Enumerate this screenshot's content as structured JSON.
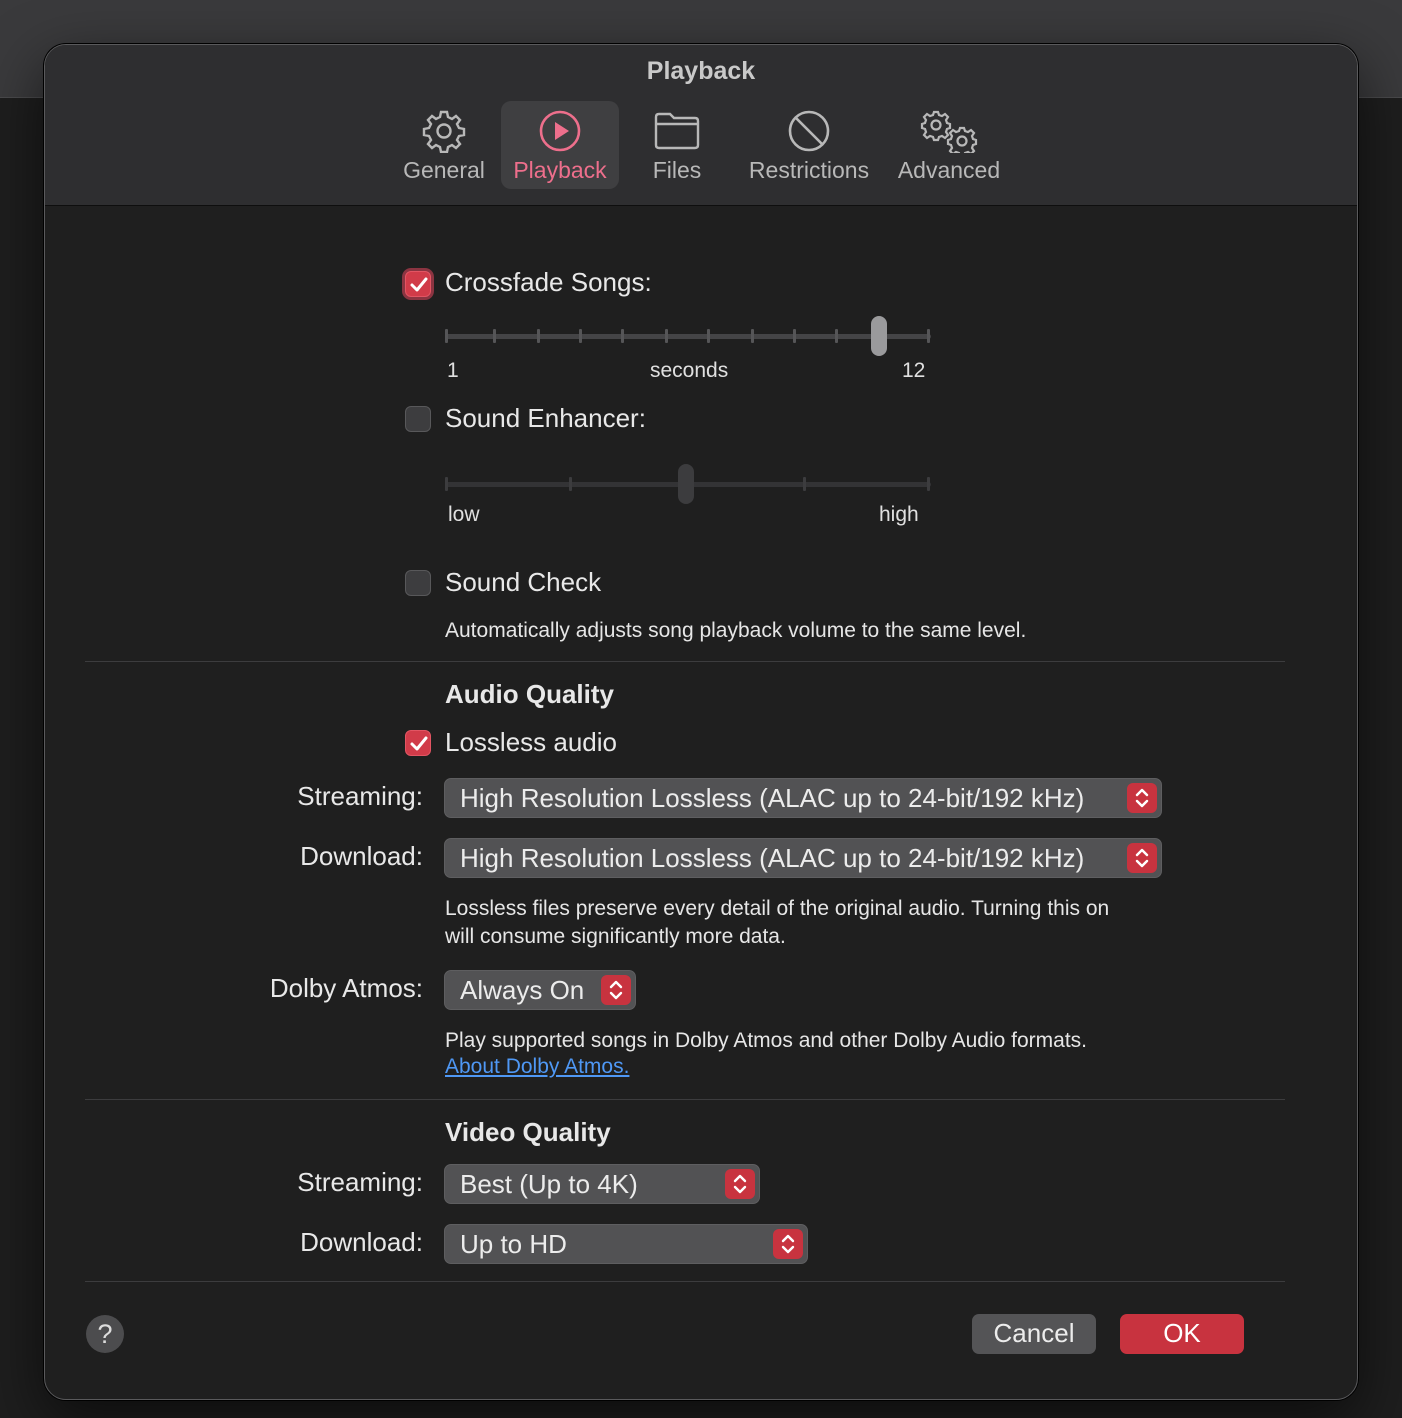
{
  "window": {
    "title": "Playback"
  },
  "tabs": [
    {
      "label": "General",
      "icon": "gear-icon"
    },
    {
      "label": "Playback",
      "icon": "play-circle-icon",
      "selected": true
    },
    {
      "label": "Files",
      "icon": "folder-icon"
    },
    {
      "label": "Restrictions",
      "icon": "prohibited-icon"
    },
    {
      "label": "Advanced",
      "icon": "gears-icon"
    }
  ],
  "crossfade": {
    "label": "Crossfade Songs:",
    "checked": true,
    "min_label": "1",
    "unit_label": "seconds",
    "max_label": "12",
    "value": 11
  },
  "sound_enhancer": {
    "label": "Sound Enhancer:",
    "checked": false,
    "low_label": "low",
    "high_label": "high",
    "level": 0.5
  },
  "sound_check": {
    "label": "Sound Check",
    "checked": false,
    "description": "Automatically adjusts song playback volume to the same level."
  },
  "audio_quality": {
    "heading": "Audio Quality",
    "lossless": {
      "label": "Lossless audio",
      "checked": true
    },
    "streaming_label": "Streaming:",
    "streaming_value": "High Resolution Lossless (ALAC up to 24-bit/192 kHz)",
    "download_label": "Download:",
    "download_value": "High Resolution Lossless (ALAC up to 24-bit/192 kHz)",
    "lossless_note_line1": "Lossless files preserve every detail of the original audio. Turning this on",
    "lossless_note_line2": "will consume significantly more data.",
    "dolby_label": "Dolby Atmos:",
    "dolby_value": "Always On",
    "dolby_note": "Play supported songs in Dolby Atmos and other Dolby Audio formats.",
    "dolby_link": "About Dolby Atmos."
  },
  "video_quality": {
    "heading": "Video Quality",
    "streaming_label": "Streaming:",
    "streaming_value": "Best (Up to 4K)",
    "download_label": "Download:",
    "download_value": "Up to HD"
  },
  "footer": {
    "help": "?",
    "cancel": "Cancel",
    "ok": "OK"
  },
  "colors": {
    "accent": "#c8333f",
    "tab_selected": "#ee6f8c",
    "link": "#4f98f5"
  }
}
